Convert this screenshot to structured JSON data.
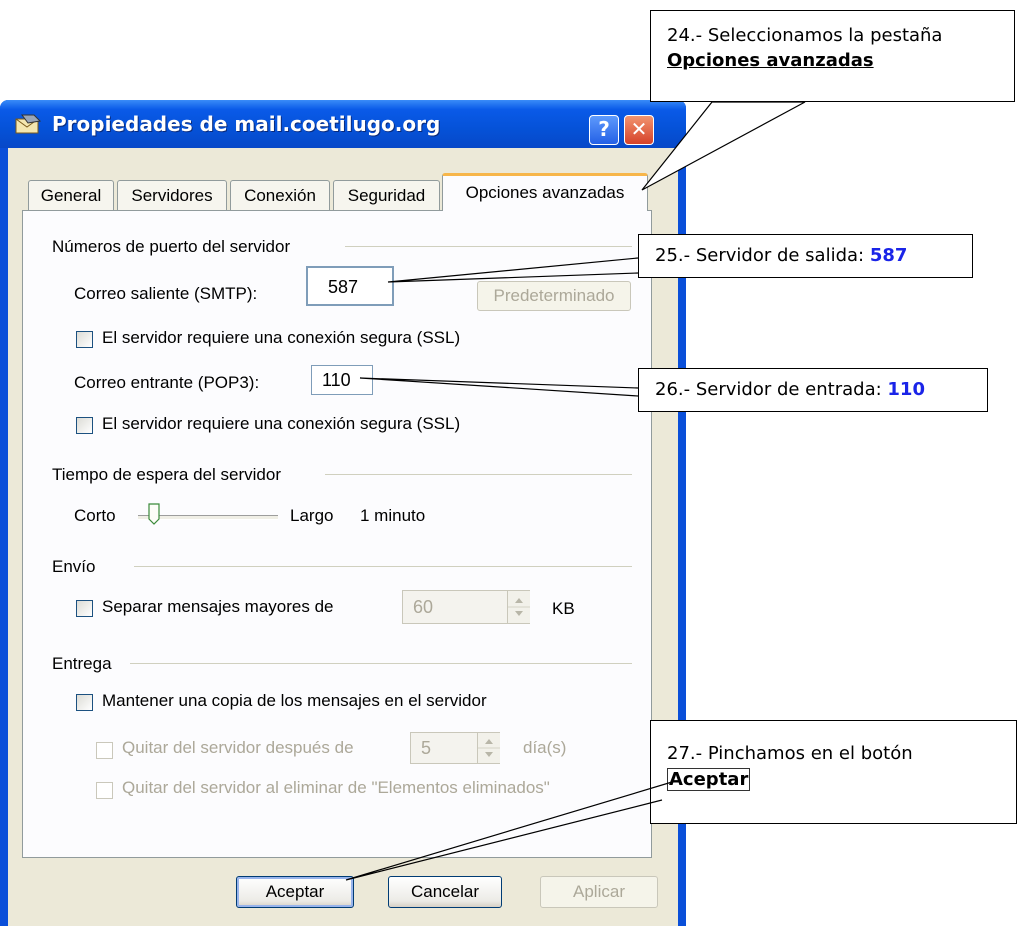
{
  "window": {
    "title": "Propiedades de mail.coetilugo.org",
    "help_label": "?",
    "close_label": "✕",
    "icon": "mail-envelope-icon"
  },
  "tabs": [
    {
      "label": "General"
    },
    {
      "label": "Servidores"
    },
    {
      "label": "Conexión"
    },
    {
      "label": "Seguridad"
    },
    {
      "label": "Opciones avanzadas",
      "selected": true
    }
  ],
  "ports": {
    "group_title": "Números de puerto del servidor",
    "smtp_label": "Correo saliente (SMTP):",
    "smtp_value": "587",
    "default_button": "Predeterminado",
    "ssl_smtp_label": "El servidor requiere una conexión segura (SSL)",
    "pop3_label": "Correo entrante (POP3):",
    "pop3_value": "110",
    "ssl_pop3_label": "El servidor requiere una conexión segura (SSL)"
  },
  "timeout": {
    "group_title": "Tiempo de espera del servidor",
    "short_label": "Corto",
    "long_label": "Largo",
    "value_label": "1 minuto"
  },
  "sending": {
    "group_title": "Envío",
    "split_label": "Separar mensajes mayores de",
    "split_value": "60",
    "unit": "KB"
  },
  "delivery": {
    "group_title": "Entrega",
    "keep_copy_label": "Mantener una copia de los mensajes en el servidor",
    "remove_after_label": "Quitar del servidor después de",
    "remove_after_value": "5",
    "days_unit": "día(s)",
    "remove_deleted_label": "Quitar del servidor al eliminar de \"Elementos eliminados\""
  },
  "buttons": {
    "ok": "Aceptar",
    "cancel": "Cancelar",
    "apply": "Aplicar"
  },
  "callouts": {
    "c24_text": "24.- Seleccionamos la pestaña",
    "c24_bold": "Opciones avanzadas",
    "c25_text": "25.- Servidor de salida: ",
    "c25_value": "587",
    "c26_text": "26.- Servidor de entrada: ",
    "c26_value": "110",
    "c27_text": "27.- Pinchamos en el botón",
    "c27_bold": "Aceptar"
  },
  "colors": {
    "title_bar": "#0552d8",
    "dialog_bg": "#ece9d8",
    "callout_highlight": "#1a24e8",
    "active_tab_accent": "#f7b64a"
  }
}
